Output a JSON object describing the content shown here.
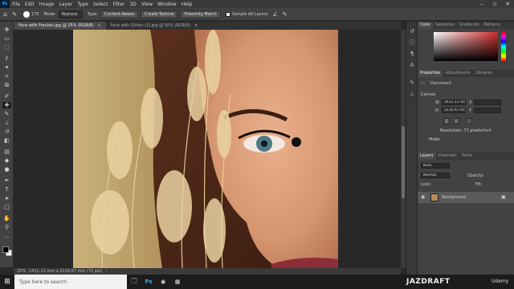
{
  "app": {
    "logo": "Ps"
  },
  "menu": [
    "File",
    "Edit",
    "Image",
    "Layer",
    "Type",
    "Select",
    "Filter",
    "3D",
    "View",
    "Window",
    "Help"
  ],
  "window_controls": {
    "minimize": "–",
    "maximize": "▫",
    "close": "✕"
  },
  "options_bar": {
    "brush_size": "175",
    "mode_label": "Mode:",
    "mode_value": "Replace",
    "type_label": "Type:",
    "content_aware": "Content-Aware",
    "create_texture": "Create Texture",
    "proximity_match": "Proximity Match",
    "sample_all_layers": "Sample All Layers",
    "angle_icon": "∠",
    "pressure_icon": "✎"
  },
  "tools": [
    {
      "name": "move",
      "glyph": "✥"
    },
    {
      "name": "artboard",
      "glyph": "▭"
    },
    {
      "name": "marquee",
      "glyph": "⬚"
    },
    {
      "name": "lasso",
      "glyph": "ℓ"
    },
    {
      "name": "quick-select",
      "glyph": "✦"
    },
    {
      "name": "crop",
      "glyph": "⌗"
    },
    {
      "name": "frame",
      "glyph": "⊠"
    },
    {
      "name": "eyedropper",
      "glyph": "✐"
    },
    {
      "name": "spot-healing",
      "glyph": "✚"
    },
    {
      "name": "brush",
      "glyph": "✎"
    },
    {
      "name": "clone-stamp",
      "glyph": "⊥"
    },
    {
      "name": "history-brush",
      "glyph": "↺"
    },
    {
      "name": "eraser",
      "glyph": "◧"
    },
    {
      "name": "gradient",
      "glyph": "▤"
    },
    {
      "name": "blur",
      "glyph": "◆"
    },
    {
      "name": "dodge",
      "glyph": "●"
    },
    {
      "name": "pen",
      "glyph": "✒"
    },
    {
      "name": "type",
      "glyph": "T"
    },
    {
      "name": "path-select",
      "glyph": "➤"
    },
    {
      "name": "rectangle",
      "glyph": "□"
    },
    {
      "name": "hand",
      "glyph": "✋"
    },
    {
      "name": "zoom",
      "glyph": "⚲"
    },
    {
      "name": "more",
      "glyph": "…"
    }
  ],
  "tabs": [
    {
      "label": "Face with Freckes.jpg @ 25% (RGB/8)",
      "close": "×"
    },
    {
      "label": "Face with Glitter (1).jpg @ 50% (RGB/8)",
      "close": "×"
    }
  ],
  "status": {
    "zoom": "25%",
    "doc_info": "1411.11 mm x 2116.67 mm (72 ppi)",
    "arrow": "›"
  },
  "panels": {
    "color_tabs": [
      "Color",
      "Swatches",
      "Gradients",
      "Patterns"
    ],
    "properties_tabs": [
      "Properties",
      "Adjustments",
      "Libraries"
    ],
    "document_label": "Document",
    "canvas_label": "Canvas",
    "w_label": "W",
    "w_value": "1411.11 mm",
    "h_label": "H",
    "h_value": "2116.67 mm",
    "x_label": "X",
    "y_label": "Y",
    "resolution": "Resolution: 72 pixels/inch",
    "mode_label": "Mode",
    "layers_tabs": [
      "Layers",
      "Channels",
      "Paths"
    ],
    "kind_label": "Kind",
    "normal_label": "Normal",
    "opacity_label": "Opacity:",
    "lock_label": "Lock:",
    "fill_label": "Fill:",
    "layer_name": "Background",
    "eye_icon": "👁",
    "lock_icon": "🔒"
  },
  "taskbar": {
    "start_icon": "⊞",
    "search_placeholder": "Type here to search",
    "brand": "JAZDRAFT",
    "udemy": "Udemy",
    "icons": [
      "🗔",
      "Ps",
      "◉",
      "▦"
    ]
  },
  "colors": {
    "foreground": "#000000",
    "background": "#ffffff",
    "picker_hue": "#d42a2a"
  }
}
